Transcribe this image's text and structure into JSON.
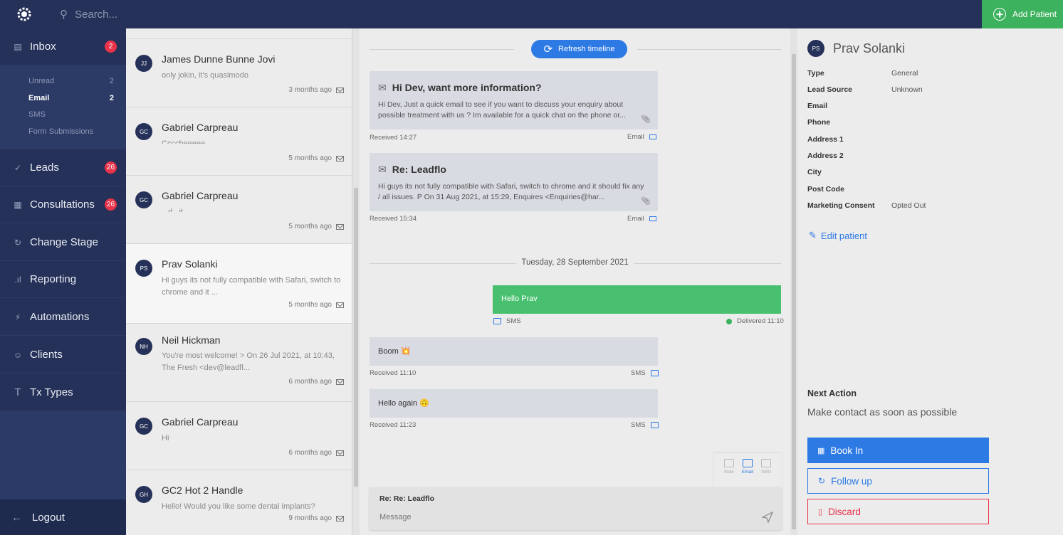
{
  "header": {
    "search_placeholder": "Search...",
    "add_patient_label": "Add Patient"
  },
  "sidebar": {
    "items": [
      {
        "label": "Inbox",
        "icon": "inbox-icon",
        "badge": "2"
      },
      {
        "label": "Leads",
        "icon": "check-circle-icon",
        "badge": "26"
      },
      {
        "label": "Consultations",
        "icon": "calendar-icon",
        "badge": "26"
      },
      {
        "label": "Change Stage",
        "icon": "sync-icon"
      },
      {
        "label": "Reporting",
        "icon": "bar-chart-icon"
      },
      {
        "label": "Automations",
        "icon": "lightning-icon"
      },
      {
        "label": "Clients",
        "icon": "users-icon"
      },
      {
        "label": "Tx Types",
        "icon": "text-icon"
      }
    ],
    "inbox_sub": [
      {
        "label": "Unread",
        "count": "2"
      },
      {
        "label": "Email",
        "count": "2"
      },
      {
        "label": "SMS",
        "count": ""
      },
      {
        "label": "Form Submissions",
        "count": ""
      }
    ],
    "logout_label": "Logout"
  },
  "conversations": [
    {
      "initials": "JJ",
      "name": "James Dunne Bunne Jovi",
      "preview": "only jokin, it's quasimodo",
      "time": "3 months ago"
    },
    {
      "initials": "GC",
      "name": "Gabriel Carpreau",
      "preview": "Ccccheeeee",
      "time": "5 months ago"
    },
    {
      "initials": "GC",
      "name": "Gabriel Carpreau",
      "preview": "...d...it...",
      "time": "5 months ago"
    },
    {
      "initials": "PS",
      "name": "Prav Solanki",
      "preview": "Hi guys its not fully compatible with Safari, switch to chrome and it ...",
      "time": "5 months ago"
    },
    {
      "initials": "NH",
      "name": "Neil Hickman",
      "preview": "You're most welcome! > On 26 Jul 2021, at 10:43, The Fresh <dev@leadfl...",
      "time": "6 months ago"
    },
    {
      "initials": "GC",
      "name": "Gabriel Carpreau",
      "preview": "Hi",
      "time": "6 months ago"
    },
    {
      "initials": "GH",
      "name": "GC2 Hot 2 Handle",
      "preview": "Hello! Would you like some dental implants?",
      "time": "9 months ago"
    }
  ],
  "timeline": {
    "refresh_label": "Refresh timeline",
    "emails": [
      {
        "title": "Hi Dev, want more information?",
        "body": "Hi Dev, Just a quick email to see if you want to discuss your enquiry about possible treatment with us ? Im available for a quick chat on the phone or...",
        "received": "Received 14:27",
        "channel": "Email"
      },
      {
        "title": "Re: Leadflo",
        "body": "Hi guys its not fully compatible with Safari, switch to chrome and it should fix any / all issues. P On 31 Aug 2021, at 15:29, Enquires <Enquiries@har...",
        "received": "Received 15:34",
        "channel": "Email"
      }
    ],
    "date_separator": "Tuesday, 28 September 2021",
    "outgoing": {
      "text": "Hello Prav",
      "channel": "SMS",
      "status": "Delivered 11:10"
    },
    "incoming": [
      {
        "text": "Boom 💥",
        "received": "Received 11:10",
        "channel": "SMS"
      },
      {
        "text": "Hello again 🙃",
        "received": "Received 11:23",
        "channel": "SMS"
      }
    ],
    "composer_tabs": [
      "Note",
      "Email",
      "SMS"
    ],
    "composer_subject": "Re: Re: Leadflo",
    "composer_placeholder": "Message"
  },
  "patient": {
    "initials": "PS",
    "name": "Prav Solanki",
    "fields": [
      {
        "label": "Type",
        "value": "General"
      },
      {
        "label": "Lead Source",
        "value": "Unknown"
      },
      {
        "label": "Email",
        "value": ""
      },
      {
        "label": "Phone",
        "value": ""
      },
      {
        "label": "Address 1",
        "value": ""
      },
      {
        "label": "Address 2",
        "value": ""
      },
      {
        "label": "City",
        "value": ""
      },
      {
        "label": "Post Code",
        "value": ""
      },
      {
        "label": "Marketing Consent",
        "value": "Opted Out"
      }
    ],
    "edit_label": "Edit patient",
    "next_action_heading": "Next Action",
    "next_action_text": "Make contact as soon as possible",
    "book_in_label": "Book In",
    "follow_up_label": "Follow up",
    "discard_label": "Discard"
  },
  "colors": {
    "navy": "#253158",
    "blue": "#2d7ae5",
    "green": "#49c070",
    "red": "#e8334a"
  }
}
